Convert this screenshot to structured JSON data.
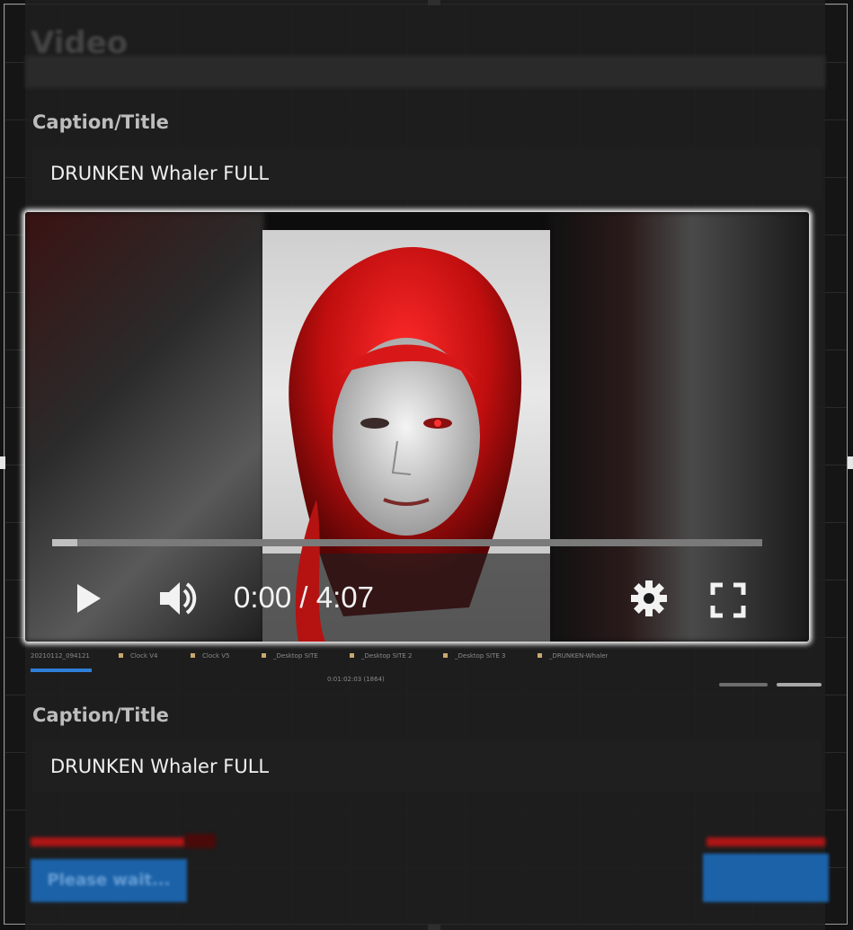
{
  "section": {
    "heading": "Video"
  },
  "fields": [
    {
      "label": "Caption/Title",
      "value": "DRUNKEN Whaler FULL"
    },
    {
      "label": "Caption/Title",
      "value": "DRUNKEN Whaler FULL"
    }
  ],
  "player": {
    "time_display": "0:00 / 4:07",
    "progress_fraction": 0.035,
    "icons": [
      "play-icon",
      "volume-icon",
      "settings-gear-icon",
      "fullscreen-icon"
    ]
  },
  "tabs": [
    {
      "label": "20210112_094121"
    },
    {
      "label": "Clock V4"
    },
    {
      "label": "Clock V5"
    },
    {
      "label": "_Desktop SITE"
    },
    {
      "label": "_Desktop SITE 2"
    },
    {
      "label": "_Desktop SITE 3"
    },
    {
      "label": "_DRUNKEN-Whaler"
    }
  ],
  "timeline": {
    "timecode": "0:01:02:03 (1864)"
  },
  "footer": {
    "wait_label": "Please wait..."
  },
  "colors": {
    "accent_blue": "#1b62a8",
    "tab_underline": "#2f7fd8",
    "alert_red": "#b01515"
  }
}
